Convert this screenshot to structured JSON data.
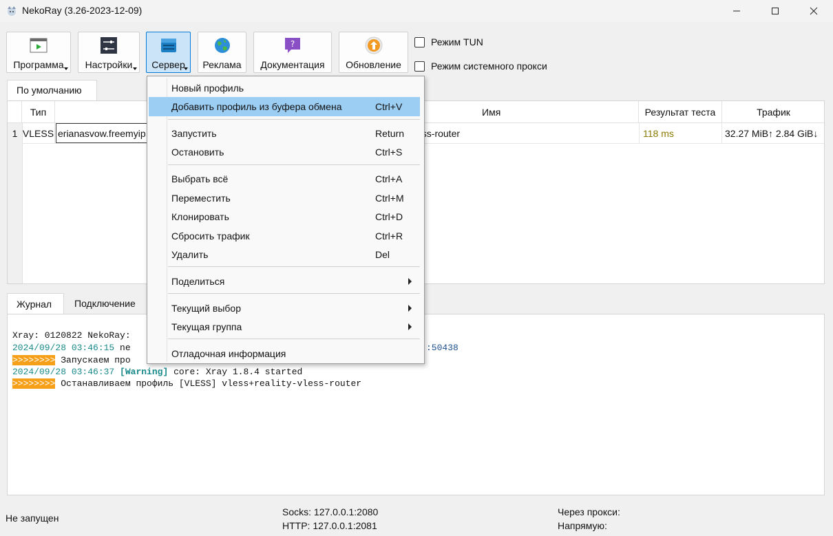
{
  "window": {
    "title": "NekoRay (3.26-2023-12-09)"
  },
  "toolbar": {
    "buttons": [
      {
        "label": "Программа"
      },
      {
        "label": "Настройки"
      },
      {
        "label": "Сервер"
      },
      {
        "label": "Реклама"
      },
      {
        "label": "Документация"
      },
      {
        "label": "Обновление"
      }
    ],
    "checkboxes": [
      {
        "label": "Режим TUN",
        "checked": false
      },
      {
        "label": "Режим системного прокси",
        "checked": false
      }
    ]
  },
  "groups": {
    "active_tab": "По умолчанию"
  },
  "table": {
    "headers": {
      "type": "Тип",
      "name": "Имя",
      "test": "Результат теста",
      "traffic": "Трафик"
    },
    "rows": [
      {
        "index": "1",
        "type": "VLESS",
        "address": "erianasvow.freemyip",
        "name": "ess-router",
        "test": "118 ms",
        "traffic": "32.27 MiB↑ 2.84 GiB↓"
      }
    ]
  },
  "bottom_tabs": {
    "log": "Журнал",
    "connection": "Подключение"
  },
  "log": {
    "line1": "Xray: 0120822 NekoRay:",
    "line2_ts": "2024/09/28 03:46:15",
    "line2_text": " ne",
    "line2_tail": ":50438",
    "line3_mark": ">>>>>>>>",
    "line3_text": " Запускаем про",
    "line4_ts": "2024/09/28 03:46:37",
    "line4_level": "[Warning]",
    "line4_text": " core: Xray 1.8.4 started",
    "line5_mark": ">>>>>>>>",
    "line5_text": " Останавливаем профиль [VLESS] vless+reality-vless-router"
  },
  "status": {
    "state": "Не запущен",
    "socks": "Socks: 127.0.0.1:2080",
    "http": "HTTP: 127.0.0.1:2081",
    "via_proxy": "Через прокси:",
    "direct": "Напрямую:"
  },
  "context_menu": {
    "new_profile": "Новый профиль",
    "add_from_clipboard": "Добавить профиль из буфера обмена",
    "add_from_clipboard_shortcut": "Ctrl+V",
    "start": "Запустить",
    "start_shortcut": "Return",
    "stop": "Остановить",
    "stop_shortcut": "Ctrl+S",
    "select_all": "Выбрать всё",
    "select_all_shortcut": "Ctrl+A",
    "move": "Переместить",
    "move_shortcut": "Ctrl+M",
    "clone": "Клонировать",
    "clone_shortcut": "Ctrl+D",
    "reset_traffic": "Сбросить трафик",
    "reset_traffic_shortcut": "Ctrl+R",
    "delete": "Удалить",
    "delete_shortcut": "Del",
    "share": "Поделиться",
    "current_selection": "Текущий выбор",
    "current_group": "Текущая группа",
    "debug_info": "Отладочная информация"
  },
  "colors": {
    "test_result": "#8a7a00",
    "log_timestamp": "#1a8a8a",
    "log_marker": "#f5a018",
    "menu_highlight": "#9ccdf2"
  }
}
